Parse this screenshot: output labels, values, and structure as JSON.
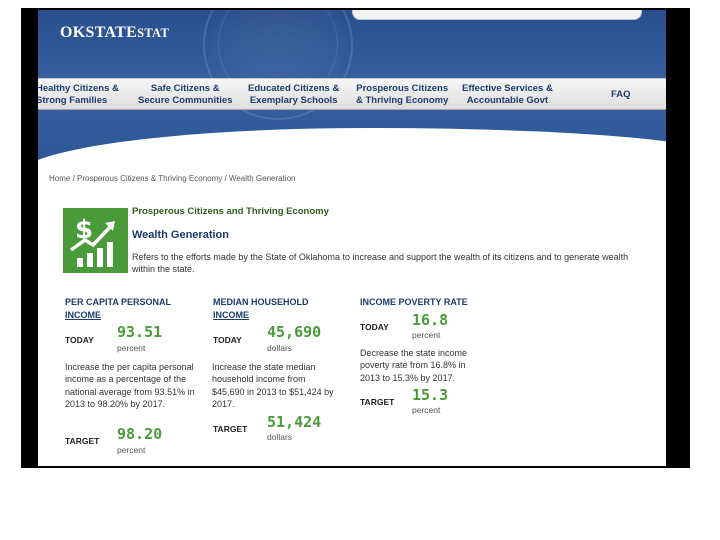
{
  "site": {
    "logo_main": "OKSTATE",
    "logo_tail": "STAT"
  },
  "nav": [
    {
      "line1": "Healthy Citizens &",
      "line2": "Strong Families"
    },
    {
      "line1": "Safe Citizens &",
      "line2": "Secure Communities"
    },
    {
      "line1": "Educated Citizens &",
      "line2": "Exemplary Schools"
    },
    {
      "line1": "Prosperous Citizens",
      "line2": "& Thriving Economy"
    },
    {
      "line1": "Effective Services &",
      "line2": "Accountable Govt"
    },
    {
      "line1": "FAQ",
      "line2": ""
    }
  ],
  "breadcrumb": "Home / Prosperous Citizens & Thriving Economy / Wealth Generation",
  "goal": {
    "subtitle": "Prosperous Citizens and Thriving Economy",
    "title": "Wealth Generation",
    "description": "Refers to the efforts made by the State of Oklahoma to increase and support the wealth of its citizens and to generate wealth within the state.",
    "icon": "dollar-growth-chart-icon",
    "icon_color": "#4a9a3a"
  },
  "metrics": [
    {
      "title_line1": "PER CAPITA PERSONAL",
      "title_line2": "INCOME",
      "today_label": "TODAY",
      "today_value": "93.51",
      "today_unit": "percent",
      "description": "Increase the per capita personal income as a percentage of the national average from 93.51% in 2013 to 98.20% by 2017.",
      "target_label": "TARGET",
      "target_value": "98.20",
      "target_unit": "percent"
    },
    {
      "title_line1": "MEDIAN HOUSEHOLD",
      "title_line2": "INCOME",
      "today_label": "TODAY",
      "today_value": "45,690",
      "today_unit": "dollars",
      "description": "Increase the state median household income from $45,690 in 2013 to $51,424 by 2017.",
      "target_label": "TARGET",
      "target_value": "51,424",
      "target_unit": "dollars"
    },
    {
      "title_line1": "INCOME POVERTY RATE",
      "title_line2": "",
      "today_label": "TODAY",
      "today_value": "16.8",
      "today_unit": "percent",
      "description": "Decrease the state income poverty rate from 16.8% in 2013 to 15.3% by 2017.",
      "target_label": "TARGET",
      "target_value": "15.3",
      "target_unit": "percent"
    }
  ],
  "colors": {
    "header_blue": "#2d5696",
    "nav_text": "#1d3b6e",
    "value_green": "#4a9a3a"
  }
}
